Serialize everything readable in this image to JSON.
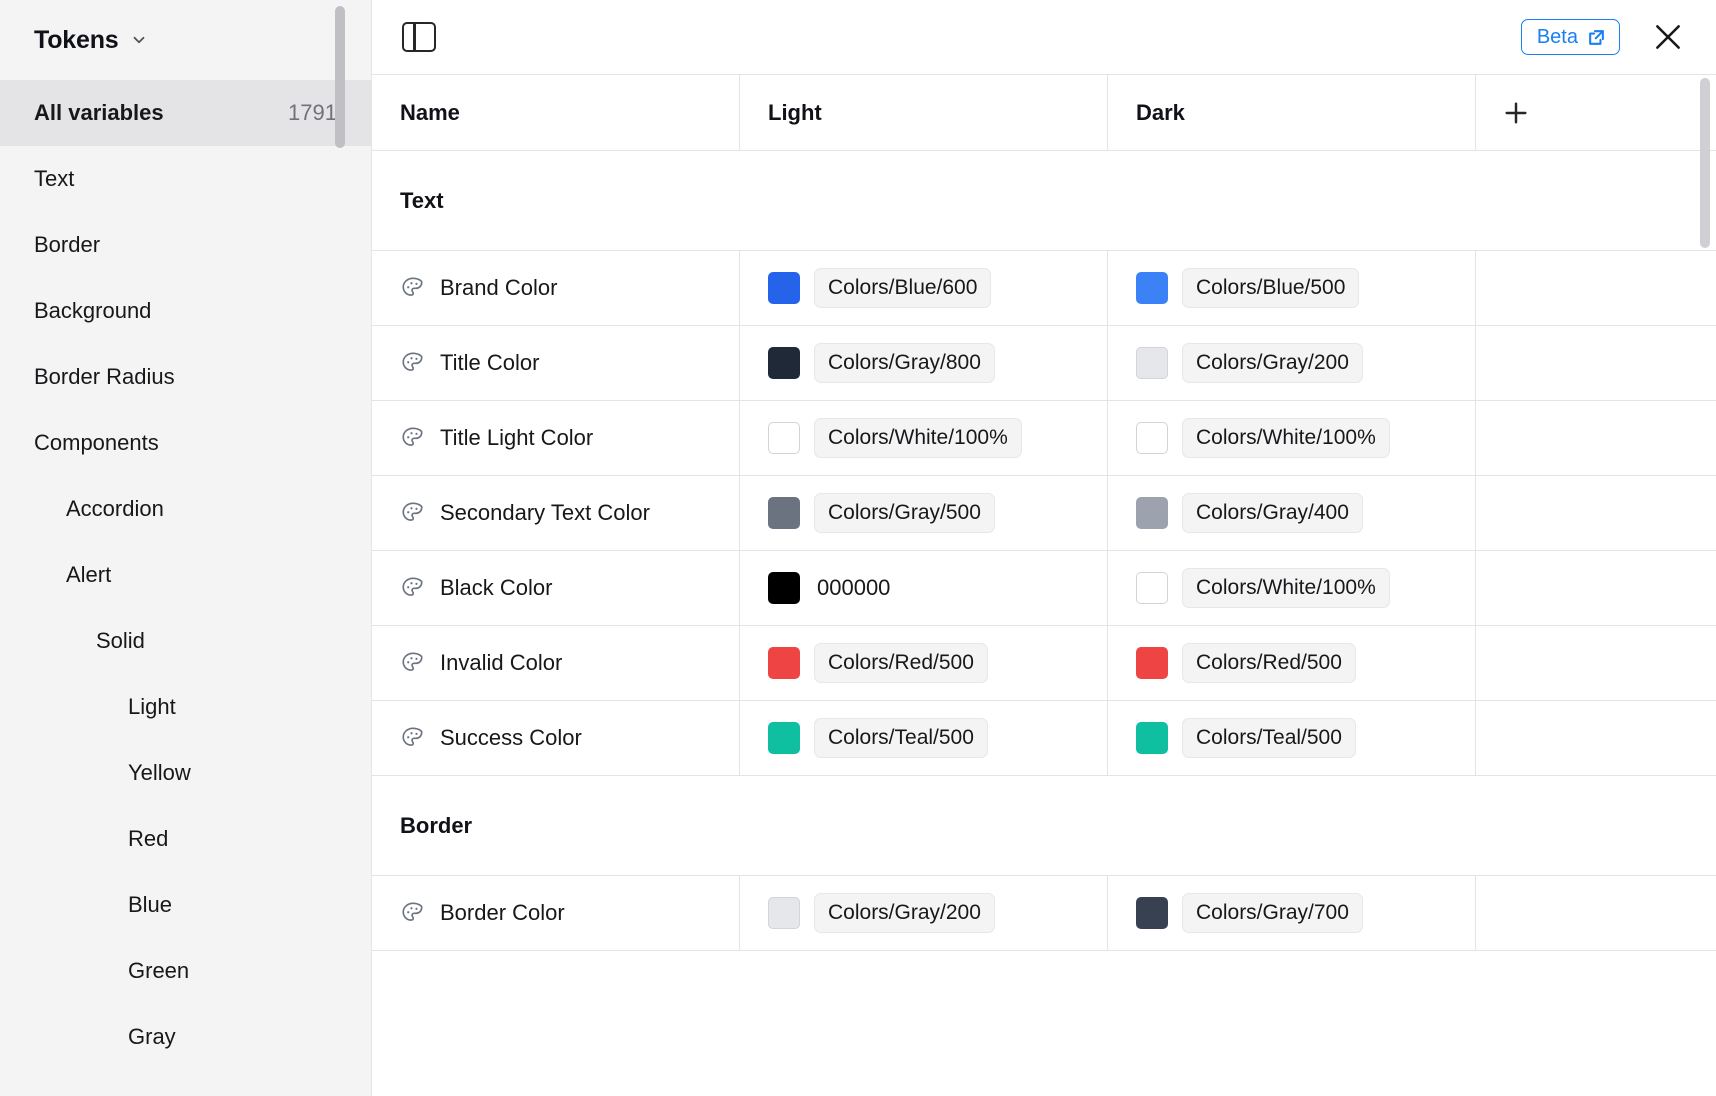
{
  "sidebar": {
    "title": "Tokens",
    "chevron_icon": "chevron-down-icon",
    "items": [
      {
        "label": "All variables",
        "count": "1791",
        "level": 0,
        "active": true
      },
      {
        "label": "Text",
        "count": "",
        "level": 0,
        "active": false
      },
      {
        "label": "Border",
        "count": "",
        "level": 0,
        "active": false
      },
      {
        "label": "Background",
        "count": "",
        "level": 0,
        "active": false
      },
      {
        "label": "Border Radius",
        "count": "",
        "level": 0,
        "active": false
      },
      {
        "label": "Components",
        "count": "",
        "level": 0,
        "active": false
      },
      {
        "label": "Accordion",
        "count": "",
        "level": 1,
        "active": false
      },
      {
        "label": "Alert",
        "count": "",
        "level": 1,
        "active": false
      },
      {
        "label": "Solid",
        "count": "",
        "level": 2,
        "active": false
      },
      {
        "label": "Light",
        "count": "",
        "level": 3,
        "active": false
      },
      {
        "label": "Yellow",
        "count": "",
        "level": 3,
        "active": false
      },
      {
        "label": "Red",
        "count": "",
        "level": 3,
        "active": false
      },
      {
        "label": "Blue",
        "count": "",
        "level": 3,
        "active": false
      },
      {
        "label": "Green",
        "count": "",
        "level": 3,
        "active": false
      },
      {
        "label": "Gray",
        "count": "",
        "level": 3,
        "active": false
      }
    ]
  },
  "toolbar": {
    "panel_toggle_icon": "panel-toggle-icon",
    "beta_label": "Beta",
    "beta_external_icon": "external-link-icon",
    "beta_color": "#1a7ff2",
    "close_icon": "close-icon"
  },
  "table": {
    "columns": [
      "Name",
      "Light",
      "Dark"
    ],
    "add_icon": "plus-icon",
    "groups": [
      {
        "title": "Text",
        "rows": [
          {
            "icon": "palette-icon",
            "name": "Brand Color",
            "light": {
              "swatch": "#2563eb",
              "value": "Colors/Blue/600",
              "is_chip": true
            },
            "dark": {
              "swatch": "#3b82f6",
              "value": "Colors/Blue/500",
              "is_chip": true
            }
          },
          {
            "icon": "palette-icon",
            "name": "Title Color",
            "light": {
              "swatch": "#1f2937",
              "value": "Colors/Gray/800",
              "is_chip": true
            },
            "dark": {
              "swatch": "#e5e7eb",
              "value": "Colors/Gray/200",
              "is_chip": true
            }
          },
          {
            "icon": "palette-icon",
            "name": "Title Light Color",
            "light": {
              "swatch": "#ffffff",
              "value": "Colors/White/100%",
              "is_chip": true
            },
            "dark": {
              "swatch": "#ffffff",
              "value": "Colors/White/100%",
              "is_chip": true
            }
          },
          {
            "icon": "palette-icon",
            "name": "Secondary Text Color",
            "light": {
              "swatch": "#6b7280",
              "value": "Colors/Gray/500",
              "is_chip": true
            },
            "dark": {
              "swatch": "#9ca3af",
              "value": "Colors/Gray/400",
              "is_chip": true
            }
          },
          {
            "icon": "palette-icon",
            "name": "Black Color",
            "light": {
              "swatch": "#000000",
              "value": "000000",
              "is_chip": false
            },
            "dark": {
              "swatch": "#ffffff",
              "value": "Colors/White/100%",
              "is_chip": true
            }
          },
          {
            "icon": "palette-icon",
            "name": "Invalid Color",
            "light": {
              "swatch": "#ef4444",
              "value": "Colors/Red/500",
              "is_chip": true
            },
            "dark": {
              "swatch": "#ef4444",
              "value": "Colors/Red/500",
              "is_chip": true
            }
          },
          {
            "icon": "palette-icon",
            "name": "Success Color",
            "light": {
              "swatch": "#0fbfa0",
              "value": "Colors/Teal/500",
              "is_chip": true
            },
            "dark": {
              "swatch": "#0fbfa0",
              "value": "Colors/Teal/500",
              "is_chip": true
            }
          }
        ]
      },
      {
        "title": "Border",
        "rows": [
          {
            "icon": "palette-icon",
            "name": "Border Color",
            "light": {
              "swatch": "#e5e7eb",
              "value": "Colors/Gray/200",
              "is_chip": true
            },
            "dark": {
              "swatch": "#374151",
              "value": "Colors/Gray/700",
              "is_chip": true
            }
          }
        ]
      }
    ]
  }
}
